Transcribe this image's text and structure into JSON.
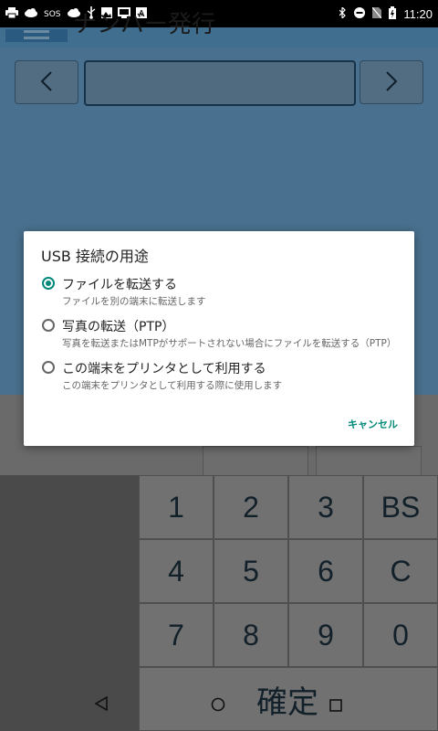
{
  "status_bar": {
    "left_icons": [
      "printer-icon",
      "cloud-icon",
      "sos-icon",
      "cloud-icon",
      "usb-icon",
      "image-icon",
      "screen-icon",
      "app-icon"
    ],
    "sos_label": "SOS",
    "right_icons": [
      "bluetooth-icon",
      "dnd-icon",
      "no-sim-icon",
      "battery-icon"
    ],
    "time": "11:20"
  },
  "app": {
    "title": "ナンバー発行",
    "prev_label": "‹",
    "next_label": "›",
    "number_value": ""
  },
  "keypad": {
    "keys": [
      "1",
      "2",
      "3",
      "BS",
      "4",
      "5",
      "6",
      "C",
      "7",
      "8",
      "9",
      "0"
    ],
    "confirm_label": "確定"
  },
  "dialog": {
    "title": "USB 接続の用途",
    "options": [
      {
        "label": "ファイルを転送する",
        "description": "ファイルを別の端末に転送します",
        "selected": true
      },
      {
        "label": "写真の転送（PTP）",
        "description": "写真を転送またはMTPがサポートされない場合にファイルを転送する（PTP）",
        "selected": false
      },
      {
        "label": "この端末をプリンタとして利用する",
        "description": "この端末をプリンタとして利用する際に使用します",
        "selected": false
      }
    ],
    "cancel_label": "キャンセル"
  },
  "colors": {
    "accent": "#00897b",
    "app_bar": "#3f6e8f"
  }
}
